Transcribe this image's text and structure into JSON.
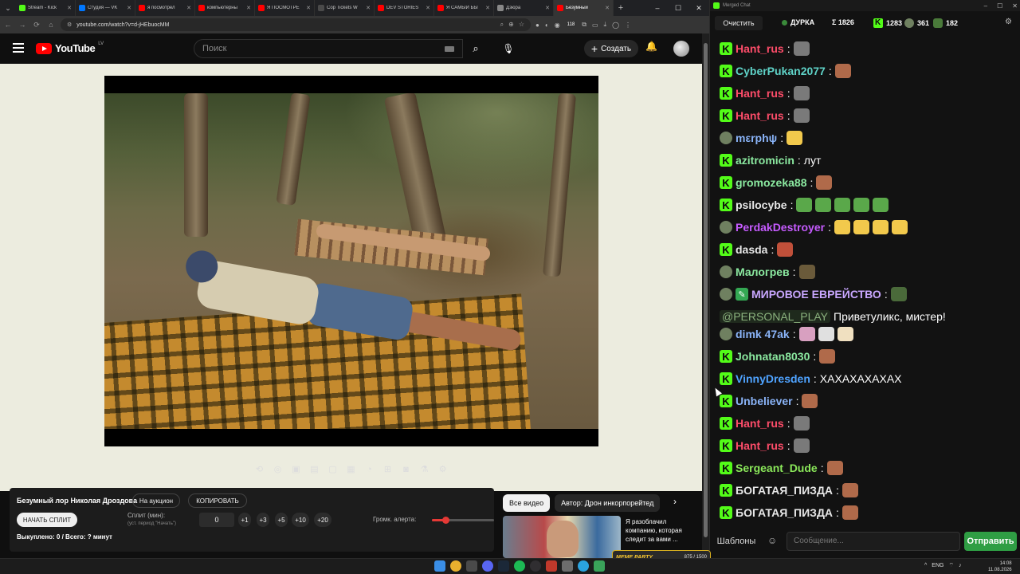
{
  "browser": {
    "tabs": [
      {
        "title": "Stream - Kick",
        "color": "#53fc18"
      },
      {
        "title": "Студия — VK",
        "color": "#0077ff"
      },
      {
        "title": "я посмотрел",
        "color": "#ff0000"
      },
      {
        "title": "компьютерны",
        "color": "#ff0000"
      },
      {
        "title": "Я ПОСМОТРЕ",
        "color": "#ff0000"
      },
      {
        "title": "Cop Tickets W",
        "color": "#4a4a4a"
      },
      {
        "title": "DEV STORIES",
        "color": "#ff0000"
      },
      {
        "title": "Я САМЫЙ БЫ",
        "color": "#ff0000"
      },
      {
        "title": "Дзюра",
        "color": "#888888"
      },
      {
        "title": "Безумный",
        "color": "#ff0000",
        "active": true
      }
    ],
    "url": "youtube.com/watch?v=d-jHEbuocMM",
    "badge_count": "118"
  },
  "youtube": {
    "logo_text": "YouTube",
    "region": "LV",
    "search_placeholder": "Поиск",
    "create_label": "Создать",
    "chips": [
      "Все видео",
      "Автор: Дрон инкорпорейтед"
    ],
    "recommendation_title": "Я разоблачил компанию, которая следит за вами ..."
  },
  "alert_panel": {
    "title": "Безумный лор Николая Дроздова",
    "auction_label": "На аукцион",
    "copy_label": "КОПИРОВАТЬ",
    "start_split_label": "НАЧАТЬ СПЛИТ",
    "split_label": "Сплит (мин):",
    "split_hint": "(уст. период \"Начать\")",
    "split_value": "0",
    "increments": [
      "+1",
      "+3",
      "+5",
      "+10",
      "+20"
    ],
    "volume_label": "Громк. алерта:",
    "volume_fraction": 0.22,
    "footer": "Выкуплено: 0 / Всего: ? минут"
  },
  "overlay": {
    "tag": "MEME PARTY",
    "counter": "875 / 1500"
  },
  "chat": {
    "window_title": "Merged Chat",
    "clear_label": "Очистить",
    "channel": "ДУРКА",
    "total": "Σ 1826",
    "kick_count": "1283",
    "sub_count": "361",
    "other_count": "182",
    "templates_label": "Шаблоны",
    "input_placeholder": "Сообщение...",
    "send_label": "Отправить",
    "messages": [
      {
        "badges": [
          "kick"
        ],
        "user": "Hant_rus",
        "color": "#ff4d6a",
        "emotes": [
          "#7a7a7a"
        ]
      },
      {
        "badges": [
          "kick"
        ],
        "user": "CyberPukan2077",
        "color": "#5fd3c8",
        "emotes": [
          "#b06a4a"
        ]
      },
      {
        "badges": [
          "kick"
        ],
        "user": "Hant_rus",
        "color": "#ff4d6a",
        "emotes": [
          "#7a7a7a"
        ]
      },
      {
        "badges": [
          "kick"
        ],
        "user": "Hant_rus",
        "color": "#ff4d6a",
        "emotes": [
          "#7a7a7a"
        ]
      },
      {
        "badges": [
          "sub"
        ],
        "user": "mεrphψ",
        "color": "#8ab4f8",
        "emotes": [
          "#f2c94c"
        ]
      },
      {
        "badges": [
          "kick"
        ],
        "user": "azitromicin",
        "color": "#8be9a0",
        "text": "лут"
      },
      {
        "badges": [
          "kick"
        ],
        "user": "gromozeka88",
        "color": "#8be9a0",
        "emotes": [
          "#b06a4a"
        ]
      },
      {
        "badges": [
          "kick"
        ],
        "user": "psilocybe",
        "color": "#e8e8e8",
        "emotes": [
          "#5aa84a",
          "#5aa84a",
          "#5aa84a",
          "#5aa84a",
          "#5aa84a"
        ]
      },
      {
        "badges": [
          "sub"
        ],
        "user": "PerdakDestroyer",
        "color": "#c65bff",
        "emotes": [
          "#f2c94c",
          "#f2c94c",
          "#f2c94c",
          "#f2c94c"
        ]
      },
      {
        "badges": [
          "kick"
        ],
        "user": "dasda",
        "color": "#e8e8e8",
        "emotes": [
          "#c0503a"
        ]
      },
      {
        "badges": [
          "sub"
        ],
        "user": "Малогрев",
        "color": "#8be9a0",
        "emotes": [
          "#6a5a3a"
        ]
      },
      {
        "badges": [
          "sub",
          "mod"
        ],
        "user": "МИРОВОЕ ЕВРЕЙСТВО",
        "color": "#c9a7ff",
        "emotes": [
          "#4a6a3a"
        ]
      },
      {
        "continuation": true,
        "mention": "@PERSONAL_PLAY",
        "text": "Приветуликс, мистер!"
      },
      {
        "badges": [
          "sub"
        ],
        "user": "dimk 47ak",
        "color": "#8ab4f8",
        "emotes": [
          "#d8a0c0",
          "#e0e0e0",
          "#f0e0c0"
        ]
      },
      {
        "badges": [
          "kick"
        ],
        "user": "Johnatan8030",
        "color": "#8be9a0",
        "emotes": [
          "#b06a4a"
        ]
      },
      {
        "badges": [
          "kick"
        ],
        "user": "VinnyDresden",
        "color": "#4fa3ff",
        "text": "ХАХАХАХАХАХ"
      },
      {
        "badges": [
          "kick"
        ],
        "user": "Unbeliever",
        "color": "#8ab4f8",
        "emotes": [
          "#b06a4a"
        ]
      },
      {
        "badges": [
          "kick"
        ],
        "user": "Hant_rus",
        "color": "#ff4d6a",
        "emotes": [
          "#7a7a7a"
        ]
      },
      {
        "badges": [
          "kick"
        ],
        "user": "Hant_rus",
        "color": "#ff4d6a",
        "emotes": [
          "#7a7a7a"
        ]
      },
      {
        "badges": [
          "kick"
        ],
        "user": "Sergeant_Dude",
        "color": "#8be95a",
        "emotes": [
          "#b06a4a"
        ]
      },
      {
        "badges": [
          "kick"
        ],
        "user": "БОГАТАЯ_ПИЗДА",
        "color": "#e8e8e8",
        "emotes": [
          "#b06a4a"
        ]
      },
      {
        "badges": [
          "kick"
        ],
        "user": "БОГАТАЯ_ПИЗДА",
        "color": "#e8e8e8",
        "emotes": [
          "#b06a4a"
        ]
      }
    ]
  },
  "taskbar": {
    "lang": "ENG",
    "time": "14:08",
    "date": "11.08.2026"
  }
}
